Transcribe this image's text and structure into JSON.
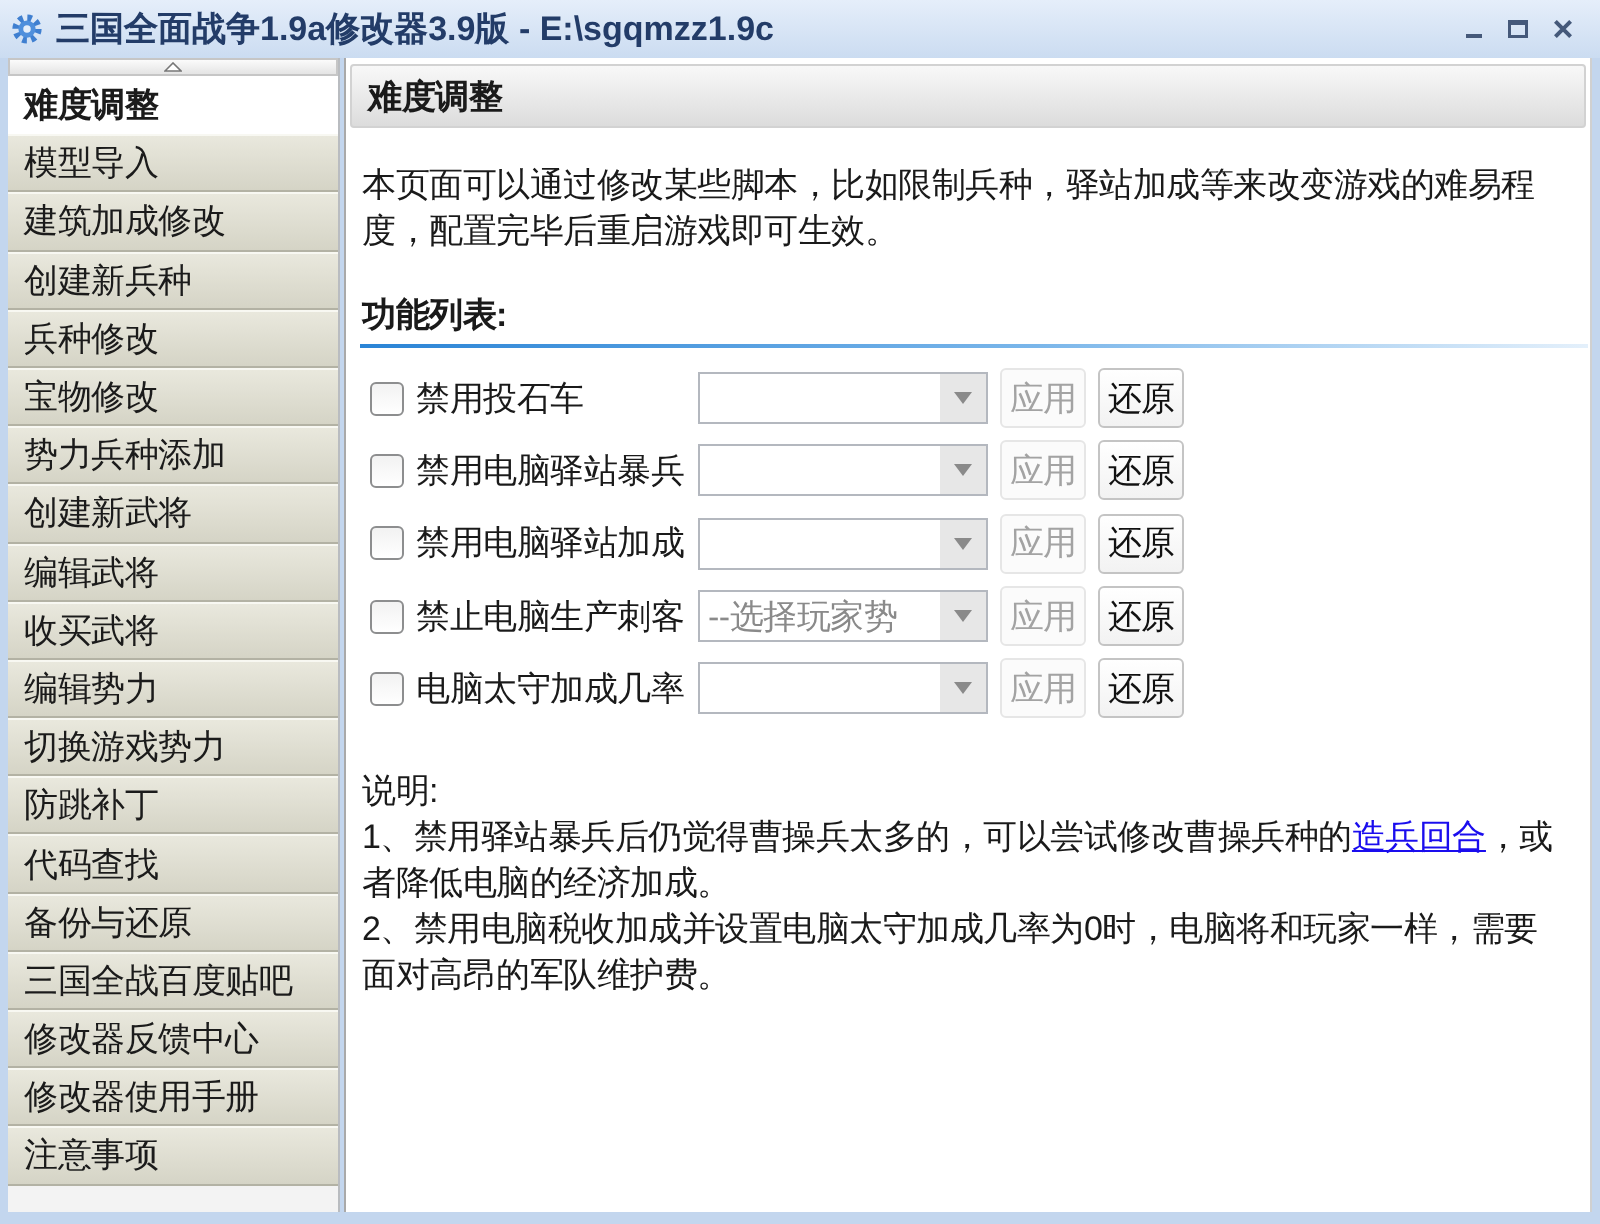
{
  "window": {
    "title": "三国全面战争1.9a修改器3.9版 - E:\\sgqmzz1.9c"
  },
  "sidebar": {
    "items": [
      {
        "label": "难度调整",
        "selected": true
      },
      {
        "label": "模型导入",
        "selected": false
      },
      {
        "label": "建筑加成修改",
        "selected": false
      },
      {
        "label": "创建新兵种",
        "selected": false
      },
      {
        "label": "兵种修改",
        "selected": false
      },
      {
        "label": "宝物修改",
        "selected": false
      },
      {
        "label": "势力兵种添加",
        "selected": false
      },
      {
        "label": "创建新武将",
        "selected": false
      },
      {
        "label": "编辑武将",
        "selected": false
      },
      {
        "label": "收买武将",
        "selected": false
      },
      {
        "label": "编辑势力",
        "selected": false
      },
      {
        "label": "切换游戏势力",
        "selected": false
      },
      {
        "label": "防跳补丁",
        "selected": false
      },
      {
        "label": "代码查找",
        "selected": false
      },
      {
        "label": "备份与还原",
        "selected": false
      },
      {
        "label": "三国全战百度贴吧",
        "selected": false
      },
      {
        "label": "修改器反馈中心",
        "selected": false
      },
      {
        "label": "修改器使用手册",
        "selected": false
      },
      {
        "label": "注意事项",
        "selected": false
      }
    ]
  },
  "panel": {
    "title": "难度调整",
    "intro": "本页面可以通过修改某些脚本，比如限制兵种，驿站加成等来改变游戏的难易程度，配置完毕后重启游戏即可生效。",
    "section_title": "功能列表:",
    "features": [
      {
        "label": "禁用投石车",
        "checked": false,
        "apply": {
          "label": "应用",
          "disabled": true
        },
        "restore": {
          "label": "还原",
          "disabled": false
        }
      },
      {
        "label": "禁用电脑驿站暴兵",
        "checked": false,
        "apply": {
          "label": "应用",
          "disabled": true
        },
        "restore": {
          "label": "还原",
          "disabled": false
        }
      },
      {
        "label": "禁用电脑驿站加成",
        "checked": false,
        "apply": {
          "label": "应用",
          "disabled": true
        },
        "restore": {
          "label": "还原",
          "disabled": false
        }
      },
      {
        "label": "禁止电脑生产刺客",
        "checked": false,
        "placeholder": "--选择玩家势",
        "apply": {
          "label": "应用",
          "disabled": true
        },
        "restore": {
          "label": "还原",
          "disabled": false
        }
      },
      {
        "label": "电脑太守加成几率",
        "checked": false,
        "apply": {
          "label": "应用",
          "disabled": true
        },
        "restore": {
          "label": "还原",
          "disabled": false
        }
      }
    ],
    "notes": {
      "title": "说明:",
      "lines": [
        {
          "text": "1、禁用驿站暴兵后仍觉得曹操兵太多的，可以尝试修改曹操兵种的",
          "link": "造兵回合",
          "after": "，或者降低电脑的经济加成。"
        },
        {
          "text": "2、禁用电脑税收加成并设置电脑太守加成几率为0时，电脑将和玩家一样，需要面对高昂的军队维护费。"
        }
      ]
    }
  }
}
